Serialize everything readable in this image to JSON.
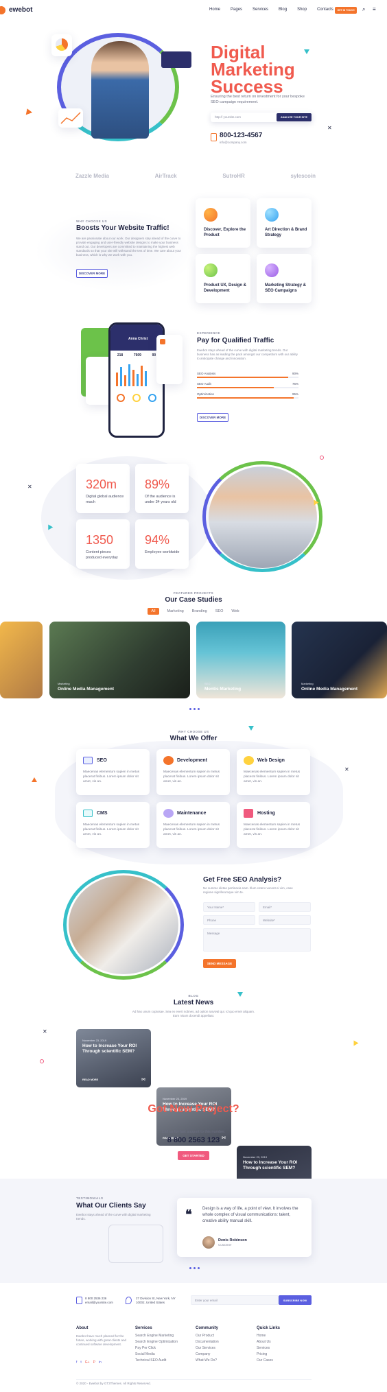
{
  "brand": {
    "name": "ewebot",
    "cta": "GET IN TOUCH"
  },
  "nav": {
    "items": [
      "Home",
      "Pages",
      "Services",
      "Blog",
      "Shop",
      "Contacts"
    ]
  },
  "hero": {
    "title_lines": [
      "Digital",
      "Marketing",
      "Success"
    ],
    "subtitle": "Ensuring the best return on investment for your bespoke SEO campaign requirement.",
    "url_placeholder": "http:// yoursite.com",
    "analyze_button": "ANALYZE YOUR SITE",
    "phone": "800-123-4567",
    "email": "info@company.com"
  },
  "logos": [
    "Zazzle Media",
    "AirTrack",
    "SutroHR",
    "sylescoin"
  ],
  "traffic": {
    "eyebrow": "WHY CHOOSE US",
    "title": "Boosts Your Website Traffic!",
    "text": "We are passionate about our work. Our designers stay ahead of the curve to provide engaging and user-friendly website designs to make your business stand out. Our developers are committed to maintaining the highest web standards so that your site will withstand the test of time. We care about your business, which is why we work with you.",
    "button": "DISCOVER MORE",
    "features": [
      {
        "title": "Discover, Explore the Product",
        "color": "#f4742b"
      },
      {
        "title": "Art Direction & Brand Strategy",
        "color": "#36a3f0"
      },
      {
        "title": "Product UX, Design & Development",
        "color": "#6cc24a"
      },
      {
        "title": "Marketing Strategy & SEO Campaigns",
        "color": "#9b5de5"
      }
    ]
  },
  "pay": {
    "eyebrow": "EXPERIENCE",
    "title": "Pay for Qualified Traffic",
    "text": "Ewebot stays ahead of the curve with digital marketing trends. Our business has as leading the pack amongst our competitors with our ability to anticipate change and innovation.",
    "bars": [
      {
        "label": "SEO Analysis",
        "value": 90
      },
      {
        "label": "SEO Audit",
        "value": 76
      },
      {
        "label": "Optimization",
        "value": 95
      }
    ],
    "button": "DISCOVER MORE",
    "phone_user": "Anna Christ",
    "phone_stats": [
      "218",
      "7609",
      "90"
    ]
  },
  "stats": [
    {
      "value": "320m",
      "label": "Digital global audience reach",
      "color": "#f05a4e"
    },
    {
      "value": "89%",
      "label": "Of the audience is under 34 years old",
      "color": "#f05a4e"
    },
    {
      "value": "1350",
      "label": "Content pieces produced everyday",
      "color": "#f05a4e"
    },
    {
      "value": "94%",
      "label": "Employee worldwide",
      "color": "#f05a4e"
    }
  ],
  "cases": {
    "eyebrow": "FEATURED PROJECTS",
    "title": "Our Case Studies",
    "tabs": [
      "All",
      "Marketing",
      "Branding",
      "SEO",
      "Web"
    ],
    "items": [
      {
        "tag": "Marketing",
        "title": "Online Media Management"
      },
      {
        "tag": "SEO",
        "title": "Mentis Marketing"
      },
      {
        "tag": "Marketing",
        "title": "Online Media Management"
      }
    ]
  },
  "offer": {
    "eyebrow": "WHY CHOOSE US",
    "title": "What We Offer",
    "services": [
      {
        "title": "SEO",
        "text": "Maecenas elementum sapien in metus placerat finibus. Lorem ipsum dolor sit amet, vis an."
      },
      {
        "title": "Development",
        "text": "Maecenas elementum sapien in metus placerat finibus. Lorem ipsum dolor sit amet, vis an."
      },
      {
        "title": "Web Design",
        "text": "Maecenas elementum sapien in metus placerat finibus. Lorem ipsum dolor sit amet, vis an."
      },
      {
        "title": "CMS",
        "text": "Maecenas elementum sapien in metus placerat finibus. Lorem ipsum dolor sit amet, vis an."
      },
      {
        "title": "Maintenance",
        "text": "Maecenas elementum sapien in metus placerat finibus. Lorem ipsum dolor sit amet, vis an."
      },
      {
        "title": "Hosting",
        "text": "Maecenas elementum sapien in metus placerat finibus. Lorem ipsum dolor sit amet, vis an."
      }
    ]
  },
  "seo_form": {
    "title": "Get Free SEO Analysis?",
    "text": "Ne summo dictas pertinacia nam. Illum cetero vocent ei vim, case regione signiferumque vim te.",
    "name": "Your Name*",
    "email": "Email*",
    "phone": "Phone",
    "website": "Website*",
    "message": "Message",
    "button": "SEND MESSAGE"
  },
  "news": {
    "eyebrow": "BLOG",
    "title": "Latest News",
    "text": "Ad has unum copiosae. Sea ex evert nobnes, ad option iusvival qui. Id quo emet aliquam. Eam nisum docendi appellaat.",
    "items": [
      {
        "date": "November 23, 2019",
        "title": "How to Increase Your ROI Through scientific SEM?",
        "more": "READ MORE"
      },
      {
        "date": "November 23, 2019",
        "title": "How to Increase Your ROI Through scientific SEM?",
        "more": "READ MORE"
      },
      {
        "date": "November 23, 2019",
        "title": "How to Increase Your ROI Through scientific SEM?",
        "more": "READ MORE"
      }
    ]
  },
  "project": {
    "title": "Got New Project?",
    "sub": "Call us for fast support to this number.",
    "phone": "8 800 2563 123",
    "button": "GET STARTED"
  },
  "testimonials": {
    "eyebrow": "TESTIMONIALS",
    "title": "What Our Clients Say",
    "text": "Ewebot stays ahead of the curve with digital marketing trends.",
    "quote": "Design is a way of life, a point of view. It involves the whole complex of visual communications: talent, creative ability manual skill.",
    "author": "Denis Robinson",
    "role": "Customer"
  },
  "footer": {
    "phone": "8 800 2536 236",
    "email": "email@yoursite.com",
    "address_1": "27 Division St, New York, NY",
    "address_2": "10002, United States",
    "subscribe_placeholder": "Enter your email",
    "subscribe_button": "SUBSCRIBE NOW",
    "about_title": "About",
    "about_text": "Ewebot have much planned for the future, working with great clients and continued software development.",
    "cols": [
      {
        "title": "Services",
        "links": [
          "Search Engine Marketing",
          "Search Engine Optimization",
          "Pay Per Click",
          "Social Media",
          "Technical SEO Audit"
        ]
      },
      {
        "title": "Community",
        "links": [
          "Our Product",
          "Documentation",
          "Our Services",
          "Company",
          "What We Do?"
        ]
      },
      {
        "title": "Quick Links",
        "links": [
          "Home",
          "About Us",
          "Services",
          "Pricing",
          "Our Cases"
        ]
      }
    ],
    "copyright": "© 2020 - Ewebot by GT3Themes. All Rights Reserved."
  },
  "colors": {
    "accent": "#f4742b",
    "heading": "#1f2340",
    "title_red": "#f05a4e",
    "purple": "#5b5fe0"
  }
}
